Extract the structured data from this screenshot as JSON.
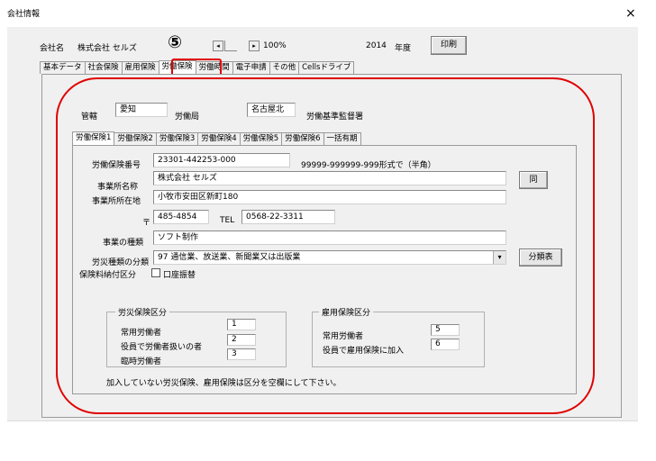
{
  "window": {
    "title": "会社情報",
    "close_glyph": "×"
  },
  "header": {
    "company_label": "会社名",
    "company_name": "株式会社 セルズ",
    "annotation_number": "⑤",
    "scroll_left": "◂",
    "scroll_right": "▸",
    "zoom": "100%",
    "year": "2014",
    "year_label": "年度",
    "print_label": "印刷"
  },
  "main_tabs": [
    "基本データ",
    "社会保険",
    "雇用保険",
    "労働保険",
    "労働時間",
    "電子申請",
    "その他",
    "Cellsドライブ"
  ],
  "jurisdiction": {
    "label": "管轄",
    "prefecture": "愛知",
    "bureau_label": "労働局",
    "office": "名古屋北",
    "office_label": "労働基準監督署"
  },
  "sub_tabs": [
    "労働保険1",
    "労働保険2",
    "労働保険3",
    "労働保険4",
    "労働保険5",
    "労働保険6",
    "一括有期"
  ],
  "form": {
    "insurance_number_label": "労働保険番号",
    "insurance_number": "23301-442253-000",
    "insurance_number_hint": "99999-999999-999形式で（半角）",
    "office_name_label": "事業所名称",
    "office_name": "株式会社 セルズ",
    "same_button": "同",
    "office_address_label": "事業所所在地",
    "office_address": "小牧市安田区新町180",
    "postal_mark": "〒",
    "postal_code": "485-4854",
    "tel_label": "TEL",
    "tel": "0568-22-3311",
    "business_type_label": "事業の種類",
    "business_type": "ソフト制作",
    "accident_category_label": "労災種類の分類",
    "accident_category": "97 通信業、放送業、新聞業又は出版業",
    "classification_button": "分類表",
    "payment_category_label": "保険料納付区分",
    "account_transfer_label": "口座振替"
  },
  "accident_group": {
    "title": "労災保険区分",
    "rows": [
      {
        "label": "常用労働者",
        "value": "1"
      },
      {
        "label": "役員で労働者扱いの者",
        "value": "2"
      },
      {
        "label": "臨時労働者",
        "value": "3"
      }
    ]
  },
  "employment_group": {
    "title": "雇用保険区分",
    "rows": [
      {
        "label": "常用労働者",
        "value": "5"
      },
      {
        "label": "役員で雇用保険に加入",
        "value": "6"
      }
    ]
  },
  "footnote": "加入していない労災保険、雇用保険は区分を空欄にして下さい。",
  "colors": {
    "highlight": "#e00000",
    "panel": "#f0f0f0"
  }
}
